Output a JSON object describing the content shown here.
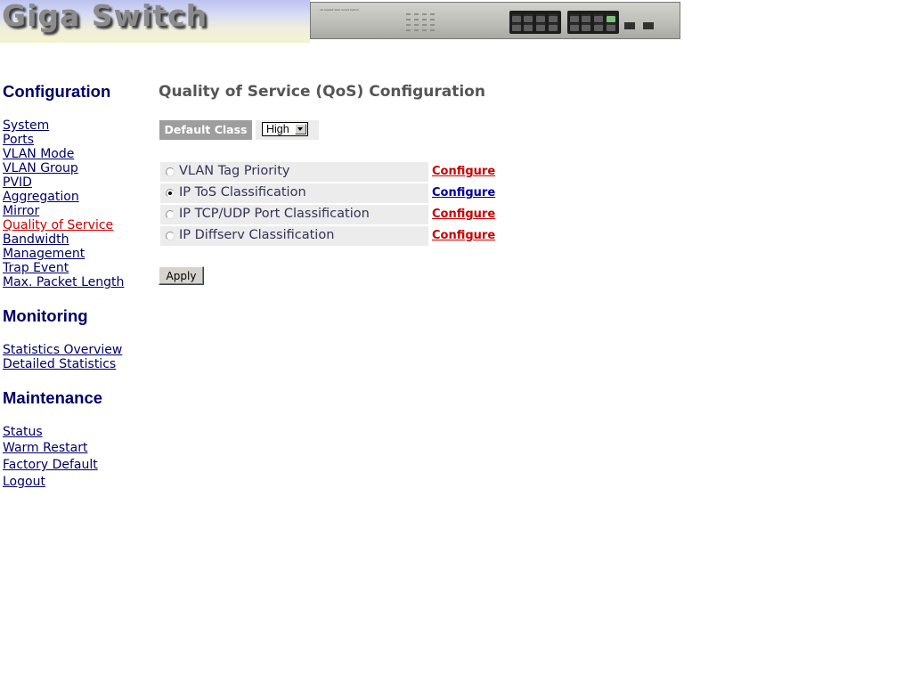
{
  "header": {
    "title": "Giga Switch",
    "device_model": "16 Gigabit Web Smart Switch"
  },
  "sidebar": {
    "configuration": {
      "heading": "Configuration",
      "items": [
        {
          "label": "System"
        },
        {
          "label": "Ports"
        },
        {
          "label": "VLAN Mode"
        },
        {
          "label": "VLAN Group"
        },
        {
          "label": "PVID"
        },
        {
          "label": "Aggregation"
        },
        {
          "label": "Mirror"
        },
        {
          "label": "Quality of Service",
          "active": true
        },
        {
          "label": "Bandwidth"
        },
        {
          "label": "Management"
        },
        {
          "label": "Trap Event"
        },
        {
          "label": "Max. Packet Length"
        }
      ]
    },
    "monitoring": {
      "heading": "Monitoring",
      "items": [
        {
          "label": "Statistics Overview"
        },
        {
          "label": "Detailed Statistics"
        }
      ]
    },
    "maintenance": {
      "heading": "Maintenance",
      "items": [
        {
          "label": "Status"
        },
        {
          "label": "Warm Restart"
        },
        {
          "label": "Factory Default"
        },
        {
          "label": "Logout"
        }
      ]
    }
  },
  "main": {
    "title": "Quality of Service (QoS) Configuration",
    "default_class": {
      "label": "Default Class",
      "selected": "High"
    },
    "qos_options": [
      {
        "label": "VLAN Tag Priority",
        "checked": false,
        "action": "Configure"
      },
      {
        "label": "IP ToS Classification",
        "checked": true,
        "action": "Configure"
      },
      {
        "label": "IP TCP/UDP Port Classification",
        "checked": false,
        "action": "Configure"
      },
      {
        "label": "IP Diffserv Classification",
        "checked": false,
        "action": "Configure"
      }
    ],
    "apply_label": "Apply"
  },
  "colors": {
    "nav_link": "#000066",
    "nav_active": "#cc0000",
    "configure_link": "#cc0000",
    "configure_link_visited": "#000099",
    "label_cell": "#9e9e9e",
    "row_bg": "#ececec",
    "title": "#555555"
  }
}
